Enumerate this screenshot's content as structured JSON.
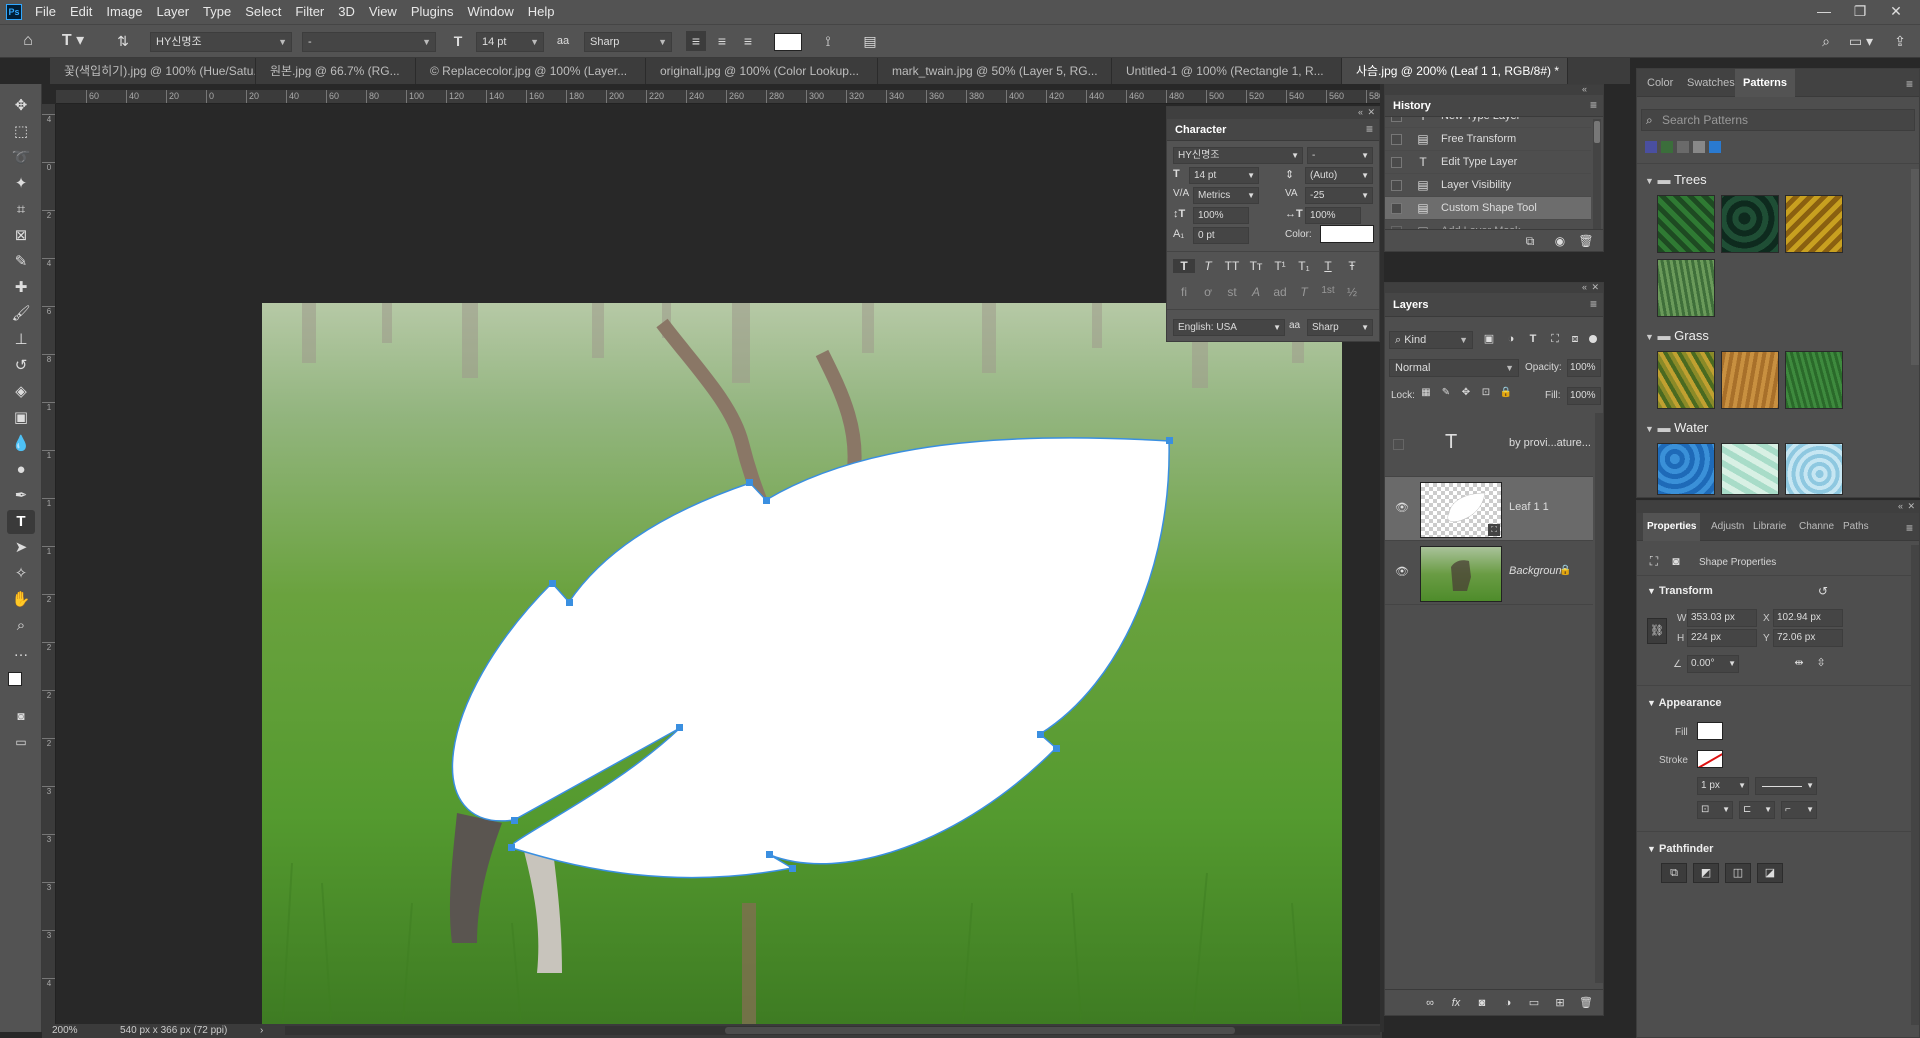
{
  "app": {
    "logo": "Ps",
    "menu": [
      "File",
      "Edit",
      "Image",
      "Layer",
      "Type",
      "Select",
      "Filter",
      "3D",
      "View",
      "Plugins",
      "Window",
      "Help"
    ]
  },
  "options_bar": {
    "font_family": "HY신명조",
    "font_style": "-",
    "font_size": "14 pt",
    "aa_label": "aa",
    "antialias": "Sharp",
    "text_color": "#ffffff"
  },
  "tabs": [
    {
      "label": "꽃(색입히기).jpg @ 100% (Hue/Satu...",
      "active": false
    },
    {
      "label": "원본.jpg @ 66.7% (RG...",
      "active": false
    },
    {
      "label": "© Replacecolor.jpg @ 100% (Layer...",
      "active": false
    },
    {
      "label": "originall.jpg @ 100% (Color Lookup...",
      "active": false
    },
    {
      "label": "mark_twain.jpg @ 50% (Layer 5, RG...",
      "active": false
    },
    {
      "label": "Untitled-1 @ 100% (Rectangle 1, R...",
      "active": false
    },
    {
      "label": "사슴.jpg @ 200% (Leaf 1 1, RGB/8#) *",
      "active": true
    }
  ],
  "ruler": {
    "h_ticks": [
      "60",
      "40",
      "20",
      "0",
      "20",
      "40",
      "60",
      "80",
      "100",
      "120",
      "140",
      "160",
      "180",
      "200",
      "220",
      "240",
      "260",
      "280",
      "300",
      "320",
      "340",
      "360",
      "380",
      "400",
      "420",
      "440",
      "460",
      "480",
      "500",
      "520",
      "540",
      "560",
      "580"
    ],
    "v_ticks": [
      "4",
      "0",
      "2",
      "4",
      "6",
      "8",
      "1",
      "1",
      "1",
      "1",
      "2",
      "2",
      "2",
      "2",
      "3",
      "3",
      "3",
      "3",
      "4"
    ]
  },
  "status": {
    "zoom": "200%",
    "doc_info": "540 px x 366 px (72 ppi)",
    "arrow": "›"
  },
  "character": {
    "title": "Character",
    "font_family": "HY신명조",
    "font_style": "-",
    "size": "14 pt",
    "leading": "(Auto)",
    "kerning": "Metrics",
    "tracking": "-25",
    "vscale": "100%",
    "hscale": "100%",
    "baseline": "0 pt",
    "color_label": "Color:",
    "language": "English: USA",
    "antialias": "Sharp",
    "aa_label": "aa",
    "style_glyphs": [
      "T",
      "T",
      "TT",
      "Tт",
      "T¹",
      "T₁",
      "T",
      "Ŧ"
    ],
    "ot_glyphs": [
      "fi",
      "ơ",
      "st",
      "A",
      "ad",
      "T",
      "1st",
      "½"
    ]
  },
  "history": {
    "title": "History",
    "items": [
      {
        "label": "New Type Layer",
        "icon": "T"
      },
      {
        "label": "Free Transform",
        "icon": "▤"
      },
      {
        "label": "Edit Type Layer",
        "icon": "T"
      },
      {
        "label": "Layer Visibility",
        "icon": "▤"
      },
      {
        "label": "Custom Shape Tool",
        "icon": "▤",
        "active": true
      },
      {
        "label": "Add Layer Mask",
        "icon": "▤"
      }
    ]
  },
  "layers": {
    "title": "Layers",
    "kind": "Kind",
    "blend": "Normal",
    "opacity_label": "Opacity:",
    "opacity": "100%",
    "lock_label": "Lock:",
    "fill_label": "Fill:",
    "fill": "100%",
    "items": [
      {
        "name": "by provi...ature...",
        "type": "text",
        "visible": false
      },
      {
        "name": "Leaf 1 1",
        "type": "shape",
        "visible": true,
        "selected": true
      },
      {
        "name": "Background",
        "type": "image",
        "visible": true,
        "locked": true
      }
    ]
  },
  "patterns_panel": {
    "tabs": [
      "Color",
      "Swatches",
      "Patterns"
    ],
    "active_tab": "Patterns",
    "search_placeholder": "Search Patterns",
    "folders": [
      {
        "name": "Trees",
        "swatches": [
          "#1e4a22",
          "#0e2a1e",
          "#c8a020",
          "#3f6f3a"
        ]
      },
      {
        "name": "Grass",
        "swatches": [
          "#8a8a28",
          "#a8702a",
          "#2a6a2a"
        ]
      },
      {
        "name": "Water",
        "swatches": [
          "#3a90d8",
          "#a8dcc8",
          "#8ec8e0"
        ]
      }
    ]
  },
  "properties": {
    "tabs": [
      "Properties",
      "Adjustn",
      "Librarie",
      "Channe",
      "Paths"
    ],
    "active_tab": "Properties",
    "header": "Shape Properties",
    "transform_title": "Transform",
    "w_label": "W",
    "w": "353.03 px",
    "h_label": "H",
    "h": "224 px",
    "x_label": "X",
    "x": "102.94 px",
    "y_label": "Y",
    "y": "72.06 px",
    "angle": "0.00°",
    "appearance_title": "Appearance",
    "fill_label": "Fill",
    "fill_color": "#ffffff",
    "stroke_label": "Stroke",
    "stroke_width": "1 px",
    "pathfinder_title": "Pathfinder"
  }
}
